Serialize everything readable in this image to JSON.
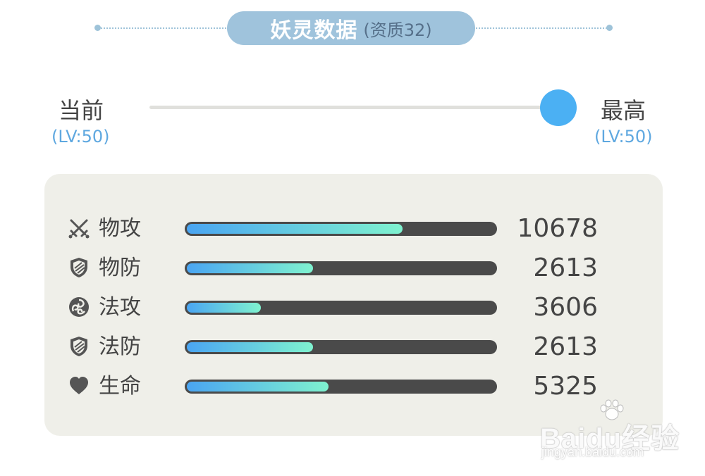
{
  "header": {
    "title": "妖灵数据",
    "subtitle": "(资质32)"
  },
  "level": {
    "current_label": "当前",
    "current_value": "(LV:50)",
    "max_label": "最高",
    "max_value": "(LV:50)",
    "slider_fraction": 1.0
  },
  "stats": [
    {
      "icon": "crossed-swords-icon",
      "label": "物攻",
      "value": "10678",
      "fill": 0.7
    },
    {
      "icon": "shield-icon",
      "label": "物防",
      "value": "2613",
      "fill": 0.41
    },
    {
      "icon": "swirl-orb-icon",
      "label": "法攻",
      "value": "3606",
      "fill": 0.24
    },
    {
      "icon": "shield-icon",
      "label": "法防",
      "value": "2613",
      "fill": 0.41
    },
    {
      "icon": "heart-icon",
      "label": "生命",
      "value": "5325",
      "fill": 0.46
    }
  ],
  "watermark": {
    "logo_text": "Baidu经验",
    "url": "jingyan.baidu.com"
  },
  "colors": {
    "title_pill": "#9fc3dc",
    "slider_thumb": "#4bb0f3",
    "level_text": "#5fa8e0",
    "panel_bg": "#efefe9",
    "bar_bg": "#4a4a4a",
    "bar_fill_start": "#4aa5f2",
    "bar_fill_end": "#7ff2cf"
  }
}
